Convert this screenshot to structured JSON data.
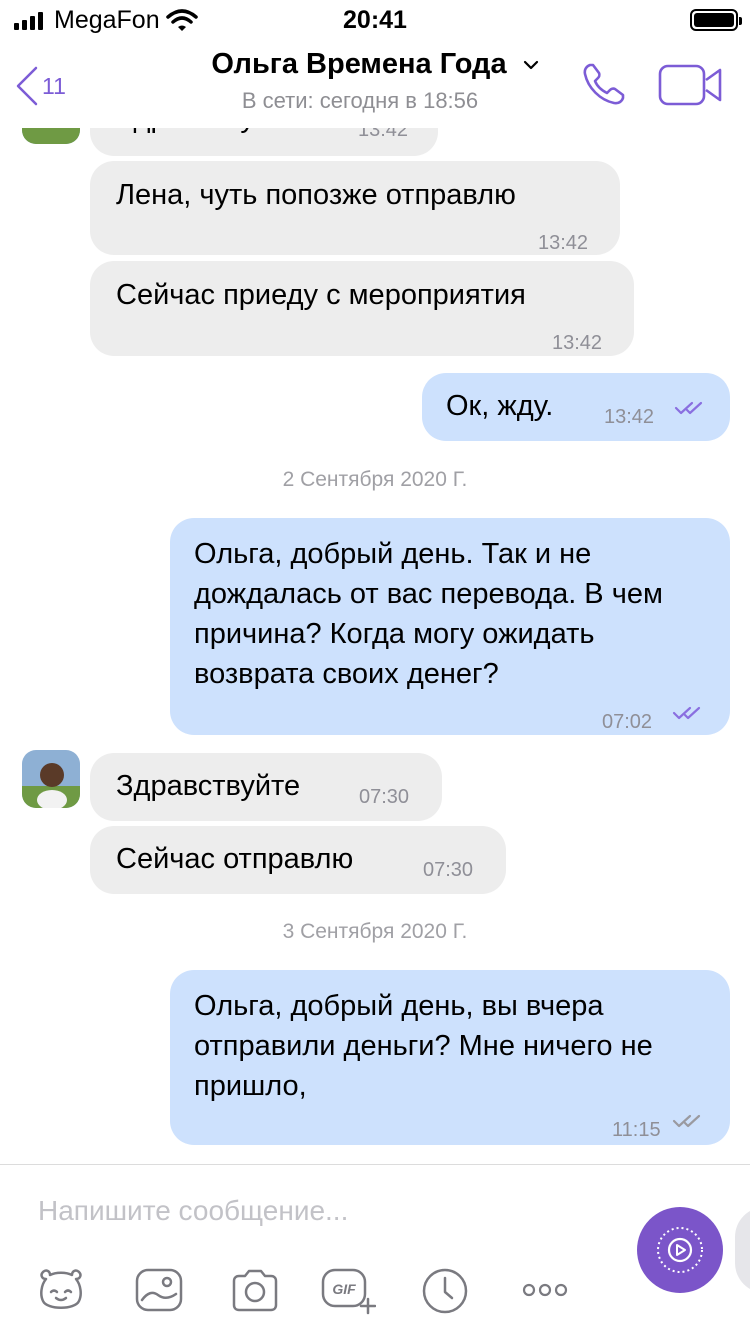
{
  "status_bar": {
    "carrier": "MegaFon",
    "time": "20:41"
  },
  "header": {
    "back_count": "11",
    "contact_name": "Ольга Времена Года",
    "contact_status": "В сети: сегодня в 18:56"
  },
  "messages": [
    {
      "dir": "in",
      "text": "Здравствуйте",
      "time": "13:42",
      "partial": true
    },
    {
      "dir": "in",
      "text": "Лена, чуть попозже отправлю",
      "time": "13:42"
    },
    {
      "dir": "in",
      "text": "Сейчас приеду с мероприятия",
      "time": "13:42"
    },
    {
      "dir": "out",
      "text": "Ок, жду.",
      "time": "13:42",
      "status": "read"
    },
    {
      "dir": "out",
      "text": "Ольга, добрый день. Так и не дождалась от вас перевода. В чем причина? Когда могу ожидать возврата своих денег?",
      "time": "07:02",
      "status": "read"
    },
    {
      "dir": "in",
      "text": "Здравствуйте",
      "time": "07:30"
    },
    {
      "dir": "in",
      "text": "Сейчас отправлю",
      "time": "07:30"
    },
    {
      "dir": "out",
      "text": "Ольга, добрый день, вы вчера отправили деньги? Мне ничего не пришло,",
      "time": "11:15",
      "status": "delivered"
    }
  ],
  "date_separators": [
    "2 Сентября 2020 Г.",
    "3 Сентября 2020 Г."
  ],
  "input": {
    "placeholder": "Напишите сообщение..."
  },
  "toolbar": {
    "icons": [
      "sticker-icon",
      "gallery-icon",
      "camera-icon",
      "gif-icon",
      "timer-icon",
      "more-icon"
    ]
  },
  "colors": {
    "accent": "#7b55c9",
    "incoming_bubble": "#ededed",
    "outgoing_bubble": "#cde1fd",
    "read_ticks": "#8a6fe0",
    "delivered_ticks": "#9a9aa0"
  }
}
